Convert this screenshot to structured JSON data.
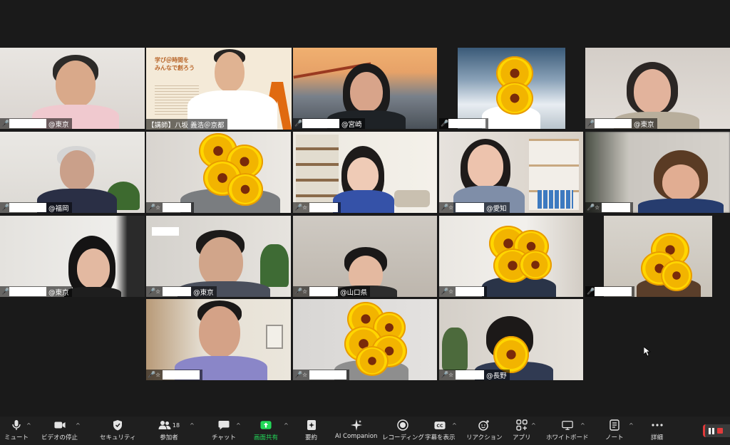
{
  "participants": [
    {
      "id": "p1",
      "location": "@東京",
      "muted": true
    },
    {
      "id": "p2",
      "label": "【講師】八坂 義浩＠京都",
      "muted": false
    },
    {
      "id": "p3",
      "location": "@宮崎",
      "muted": true
    },
    {
      "id": "p4",
      "location": "",
      "muted": true
    },
    {
      "id": "p5",
      "location": "@東京",
      "muted": true
    },
    {
      "id": "p6",
      "location": "@福岡",
      "muted": true
    },
    {
      "id": "p7",
      "location": "",
      "muted": true
    },
    {
      "id": "p8",
      "location": "",
      "muted": true
    },
    {
      "id": "p9",
      "location": "@愛知",
      "muted": true
    },
    {
      "id": "p10",
      "location": "",
      "muted": true
    },
    {
      "id": "p11",
      "location": "@東京",
      "muted": true
    },
    {
      "id": "p12",
      "location": "@東京",
      "muted": true
    },
    {
      "id": "p13",
      "location": "@山口県",
      "muted": true
    },
    {
      "id": "p14",
      "location": "",
      "muted": true
    },
    {
      "id": "p15",
      "location": "",
      "muted": true
    },
    {
      "id": "p16",
      "location": "",
      "muted": true
    },
    {
      "id": "p17",
      "location": "",
      "muted": true
    },
    {
      "id": "p18",
      "location": "@長野",
      "muted": true
    }
  ],
  "slide": {
    "title_line1": "学び＠時間を",
    "title_line2": "みんなで創ろう"
  },
  "toolbar": {
    "mute": "ミュート",
    "stop_video": "ビデオの停止",
    "security": "セキュリティ",
    "participants": "参加者",
    "participants_count": "18",
    "chat": "チャット",
    "share_screen": "画面共有",
    "summary": "要約",
    "ai_companion": "AI Companion",
    "recording": "レコーディング",
    "captions": "字幕を表示",
    "reactions": "リアクション",
    "apps": "アプリ",
    "whiteboard": "ホワイトボード",
    "notes": "ノート",
    "more": "詳細"
  },
  "colors": {
    "active_speaker": "#c8e64a",
    "share_green": "#23d959",
    "muted_red": "#ff4a4a"
  }
}
